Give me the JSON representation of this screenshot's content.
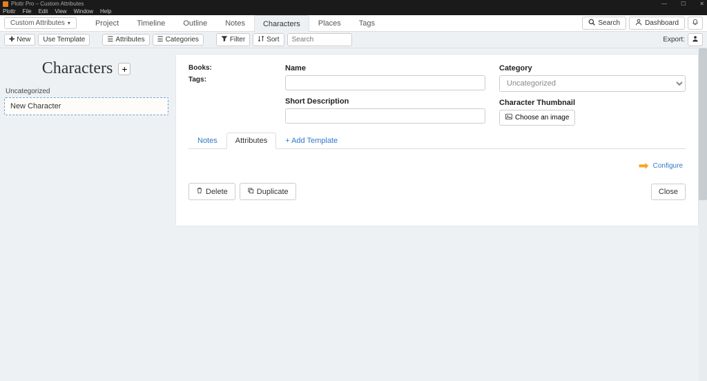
{
  "window": {
    "title": "Plottr Pro – Custom Attributes"
  },
  "menubar": [
    "Plottr",
    "File",
    "Edit",
    "View",
    "Window",
    "Help"
  ],
  "contextDropdown": "Custom Attributes",
  "navTabs": [
    "Project",
    "Timeline",
    "Outline",
    "Notes",
    "Characters",
    "Places",
    "Tags"
  ],
  "activeNavTab": "Characters",
  "topRight": {
    "search": "Search",
    "dashboard": "Dashboard"
  },
  "toolbar": {
    "new": "New",
    "useTemplate": "Use Template",
    "attributes": "Attributes",
    "categories": "Categories",
    "filter": "Filter",
    "sort": "Sort",
    "searchPlaceholder": "Search",
    "export": "Export:"
  },
  "sidebar": {
    "title": "Characters",
    "groups": [
      {
        "name": "Uncategorized",
        "items": [
          "New Character"
        ]
      }
    ]
  },
  "detail": {
    "booksLabel": "Books:",
    "tagsLabel": "Tags:",
    "nameLabel": "Name",
    "shortDescLabel": "Short Description",
    "categoryLabel": "Category",
    "categorySelected": "Uncategorized",
    "thumbLabel": "Character Thumbnail",
    "chooseImage": "Choose an image",
    "subtabs": {
      "notes": "Notes",
      "attributes": "Attributes",
      "addTemplate": "+ Add Template"
    },
    "configure": "Configure",
    "delete": "Delete",
    "duplicate": "Duplicate",
    "close": "Close"
  }
}
